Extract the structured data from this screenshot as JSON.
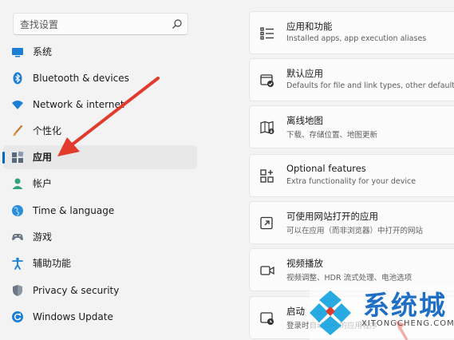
{
  "search": {
    "placeholder": "查找设置"
  },
  "sidebar": {
    "items": [
      {
        "label": "系统",
        "icon": "monitor-icon",
        "active": false
      },
      {
        "label": "Bluetooth & devices",
        "icon": "bluetooth-icon",
        "active": false
      },
      {
        "label": "Network & internet",
        "icon": "wifi-icon",
        "active": false
      },
      {
        "label": "个性化",
        "icon": "brush-icon",
        "active": false
      },
      {
        "label": "应用",
        "icon": "apps-icon",
        "active": true
      },
      {
        "label": "帐户",
        "icon": "account-icon",
        "active": false
      },
      {
        "label": "Time & language",
        "icon": "globe-icon",
        "active": false
      },
      {
        "label": "游戏",
        "icon": "gamepad-icon",
        "active": false
      },
      {
        "label": "辅助功能",
        "icon": "accessibility-icon",
        "active": false
      },
      {
        "label": "Privacy & security",
        "icon": "shield-icon",
        "active": false
      },
      {
        "label": "Windows Update",
        "icon": "refresh-icon",
        "active": false
      }
    ]
  },
  "main": {
    "cards": [
      {
        "title": "应用和功能",
        "desc": "Installed apps, app execution aliases",
        "icon": "list-icon"
      },
      {
        "title": "默认应用",
        "desc": "Defaults for file and link types, other defaults",
        "icon": "default-app-icon"
      },
      {
        "title": "离线地图",
        "desc": "下载、存储位置、地图更新",
        "icon": "map-icon"
      },
      {
        "title": "Optional features",
        "desc": "Extra functionality for your device",
        "icon": "grid-plus-icon"
      },
      {
        "title": "可使用网站打开的应用",
        "desc": "可以在应用（而非浏览器）中打开的网站",
        "icon": "web-app-icon"
      },
      {
        "title": "视频播放",
        "desc": "视频调整、HDR 流式处理、电池选项",
        "icon": "video-icon"
      },
      {
        "title": "启动",
        "desc": "登录时自动启动的应用程序",
        "icon": "startup-icon"
      }
    ]
  },
  "watermark": {
    "text": "系统城",
    "url": "XITONGCHENG.COM"
  },
  "colors": {
    "accent": "#0067c0",
    "arrow": "#e23b2e",
    "watermark": "#1f6fc5"
  }
}
